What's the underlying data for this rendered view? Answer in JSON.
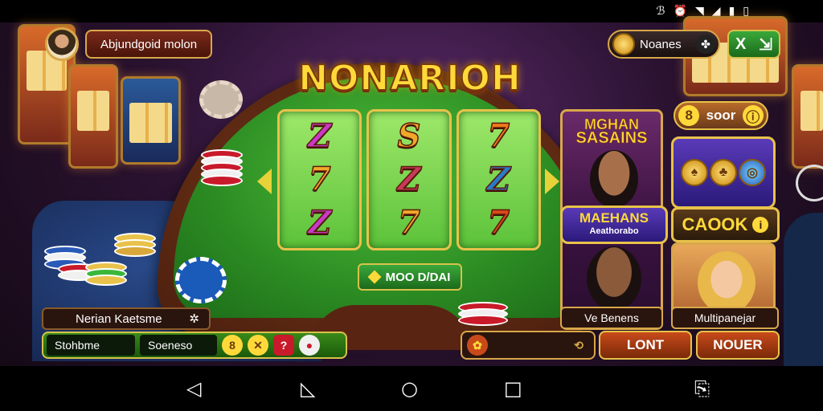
{
  "title": "NONARIOH",
  "player": {
    "name": "Abjundgoid molon"
  },
  "topbar": {
    "coins_label": "Noanes",
    "xp_button": "X"
  },
  "reels": [
    [
      "Z",
      "7",
      "Z"
    ],
    [
      "S",
      "Z",
      "7"
    ],
    [
      "7",
      "Z",
      "7"
    ]
  ],
  "mode_button": "MOO D/DAI",
  "promo": {
    "title_line1": "MGHAN",
    "title_line2": "SASAINS",
    "banner_line1": "MAEHANS",
    "banner_line2": "Aeathorabo",
    "footer": "Ve Benens"
  },
  "score_pill": {
    "label": "soor",
    "value": "8"
  },
  "cook_button": "CAOOK",
  "multi_footer": "Multipanejar",
  "info_box": "Nerian Kaetsme",
  "bottom": {
    "field1": "Stohbme",
    "field2": "Soeneso",
    "badge": "8"
  },
  "actions": {
    "lon": "LONT",
    "nouer": "NOUER"
  },
  "colors": {
    "gold": "#e8c24a",
    "felt": "#2b8a22",
    "accent_orange": "#c84a1a"
  },
  "icons": {
    "status": [
      "bluetooth-icon",
      "alarm-icon",
      "wifi-icon",
      "signal-icon",
      "sim-icon",
      "battery-icon"
    ],
    "nav": [
      "back-icon",
      "back-outline-icon",
      "home-icon",
      "recents-icon",
      "screenshot-icon"
    ]
  }
}
